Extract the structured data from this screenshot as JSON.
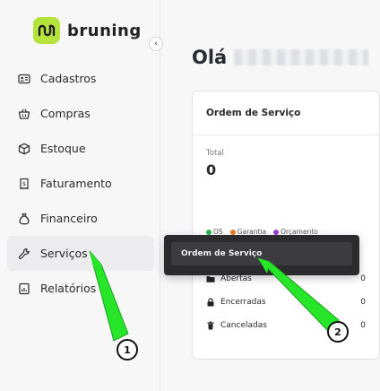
{
  "brand": {
    "name": "bruning",
    "accent": "#b6e33b"
  },
  "sidebar": {
    "collapse_icon": "chevron-left-icon",
    "items": [
      {
        "label": "Cadastros",
        "icon": "id-card-icon"
      },
      {
        "label": "Compras",
        "icon": "basket-icon"
      },
      {
        "label": "Estoque",
        "icon": "box-icon"
      },
      {
        "label": "Faturamento",
        "icon": "receipt-icon"
      },
      {
        "label": "Financeiro",
        "icon": "money-bag-icon"
      },
      {
        "label": "Serviços",
        "icon": "wrench-icon",
        "active": true
      },
      {
        "label": "Relatórios",
        "icon": "report-icon"
      }
    ]
  },
  "main": {
    "greeting": "Olá"
  },
  "card": {
    "title": "Ordem de Serviço",
    "total_label": "Total",
    "total_value": "0",
    "legend": [
      {
        "label": "OS",
        "color": "#2bb84f"
      },
      {
        "label": "Garantia",
        "color": "#f07a1c"
      },
      {
        "label": "Orçamento",
        "color": "#9a3fd0"
      }
    ],
    "stats": [
      {
        "label": "Abertas",
        "value": "0",
        "icon": "folder-icon"
      },
      {
        "label": "Encerradas",
        "value": "0",
        "icon": "lock-icon"
      },
      {
        "label": "Canceladas",
        "value": "0",
        "icon": "trash-icon"
      }
    ]
  },
  "popup": {
    "item_label": "Ordem de Serviço"
  },
  "annotations": [
    {
      "label": "1",
      "color": "#27e62a"
    },
    {
      "label": "2",
      "color": "#27e62a"
    }
  ]
}
